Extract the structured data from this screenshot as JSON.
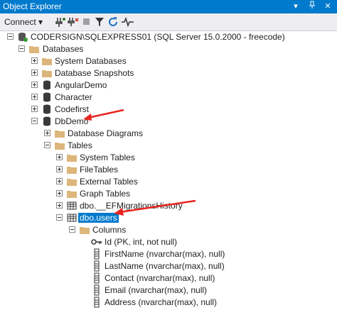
{
  "window": {
    "title": "Object Explorer",
    "buttons": [
      "▾",
      "▫",
      "✕"
    ]
  },
  "toolbar": {
    "connect_label": "Connect ▾"
  },
  "tree": {
    "server": "CODERSIGN\\SQLEXPRESS01 (SQL Server 15.0.2000 - freecode)",
    "databases": "Databases",
    "system_databases": "System Databases",
    "database_snapshots": "Database Snapshots",
    "angulardemo": "AngularDemo",
    "character": "Character",
    "codefirst": "Codefirst",
    "dbdemo": "DbDemo",
    "database_diagrams": "Database Diagrams",
    "tables": "Tables",
    "system_tables": "System Tables",
    "filetables": "FileTables",
    "external_tables": "External Tables",
    "graph_tables": "Graph Tables",
    "ef_history": "dbo.__EFMigrationsHistory",
    "dbo_users": "dbo.users",
    "columns": "Columns",
    "col_id": "Id (PK, int, not null)",
    "col_firstname": "FirstName (nvarchar(max), null)",
    "col_lastname": "LastName (nvarchar(max), null)",
    "col_contact": "Contact (nvarchar(max), null)",
    "col_email": "Email (nvarchar(max), null)",
    "col_address": "Address (nvarchar(max), null)"
  },
  "colors": {
    "accent": "#007acc",
    "arrow": "#e8251f",
    "folder": "#dcb67a"
  }
}
